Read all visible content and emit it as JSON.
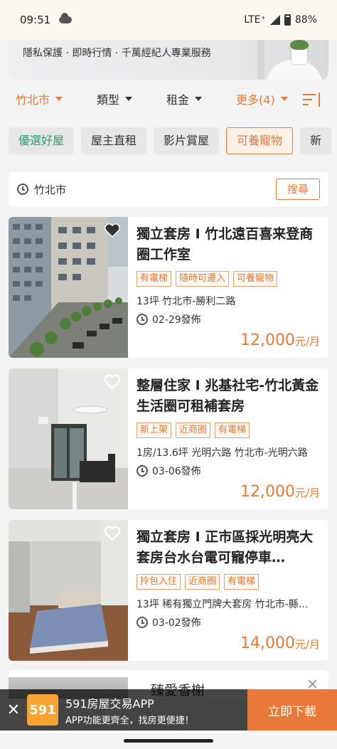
{
  "status": {
    "time": "09:51",
    "network": "LTE⁺",
    "battery": "88%"
  },
  "banner": {
    "text": "隱私保護 · 即時行情 · 千萬經紀人專業服務"
  },
  "filters": [
    {
      "label": "竹北市",
      "active": true
    },
    {
      "label": "類型",
      "active": false
    },
    {
      "label": "租金",
      "active": false
    },
    {
      "label": "更多(4)",
      "active": true
    }
  ],
  "tags": [
    "優選好屋",
    "屋主直租",
    "影片賞屋",
    "可養寵物",
    "新"
  ],
  "search": {
    "city": "竹北市",
    "button": "搜尋"
  },
  "listings": [
    {
      "title": "獨立套房 I 竹北遠百喜来登商圈工作室",
      "chips": [
        "有電梯",
        "隨時可遷入",
        "可養寵物"
      ],
      "meta": "13坪  竹北市-勝利二路",
      "date": "02-29發佈",
      "price": "12,000",
      "unit": "元/月"
    },
    {
      "title": "整層住家 I 兆基社宅-竹北黃金生活圈可租補套房",
      "chips": [
        "新上架",
        "近商圈",
        "有電梯"
      ],
      "meta": "1房/13.6坪  光明六路  竹北市-光明六路",
      "date": "03-06發佈",
      "price": "12,000",
      "unit": "元/月"
    },
    {
      "title": "獨立套房 I 正市區採光明亮大套房台水台電可寵停車…",
      "chips": [
        "拎包入住",
        "近商圈",
        "有電梯"
      ],
      "meta": "13坪  稀有獨立門牌大套房  竹北市-縣…",
      "date": "03-02發佈",
      "price": "14,000",
      "unit": "元/月"
    }
  ],
  "partial": {
    "title": "臻愛香榭"
  },
  "ad": {
    "logo": "591",
    "title": "591房屋交易APP",
    "subtitle": "APP功能更齊全，找房更便捷！",
    "button": "立即下載"
  }
}
